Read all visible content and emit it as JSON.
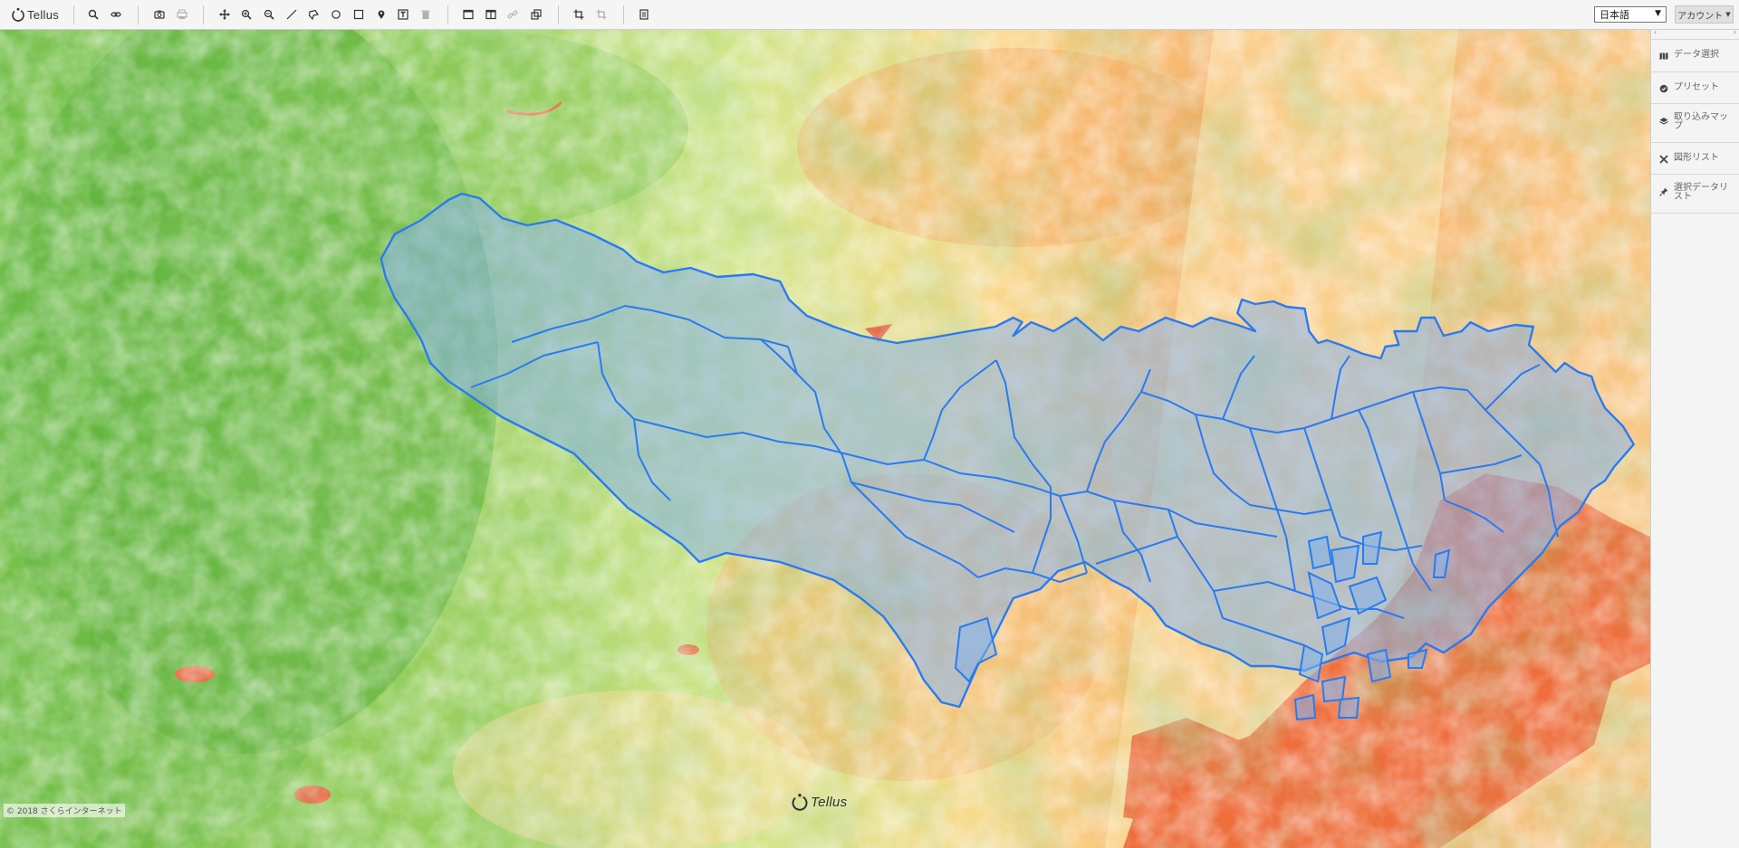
{
  "app": {
    "logo_text": "Tellus"
  },
  "toolbar": {
    "icons": [
      {
        "name": "search-icon"
      },
      {
        "name": "link-icon"
      },
      {
        "name": "camera-icon"
      },
      {
        "name": "print-icon"
      },
      {
        "name": "pan-icon"
      },
      {
        "name": "zoom-in-icon"
      },
      {
        "name": "zoom-out-icon"
      },
      {
        "name": "draw-line-icon"
      },
      {
        "name": "draw-polygon-icon"
      },
      {
        "name": "draw-circle-icon"
      },
      {
        "name": "draw-rectangle-icon"
      },
      {
        "name": "marker-icon"
      },
      {
        "name": "text-icon"
      },
      {
        "name": "trash-icon"
      },
      {
        "name": "single-view-icon"
      },
      {
        "name": "split-view-icon"
      },
      {
        "name": "sync-link-icon"
      },
      {
        "name": "overlay-icon"
      },
      {
        "name": "crop-icon"
      },
      {
        "name": "crop-disabled-icon"
      },
      {
        "name": "document-icon"
      }
    ]
  },
  "language": {
    "selected": "日本語"
  },
  "account": {
    "label": "アカウント"
  },
  "panel": {
    "items": [
      {
        "icon": "map-icon",
        "label": "データ選択"
      },
      {
        "icon": "preset-icon",
        "label": "プリセット"
      },
      {
        "icon": "layers-icon",
        "label": "取り込みマップ"
      },
      {
        "icon": "shape-list-icon",
        "label": "図形リスト"
      },
      {
        "icon": "pin-icon",
        "label": "選択データリスト"
      }
    ]
  },
  "map": {
    "copyright": "© 2018 さくらインターネット",
    "watermark": "Tellus",
    "colors": {
      "vegetation_dense": "#4fae3a",
      "vegetation": "#8fcc5a",
      "light_green": "#cbe58a",
      "pale_yellow": "#fde9a0",
      "orange": "#f5a05a",
      "urban_red": "#ee7040",
      "water_red": "#ea6a3c",
      "boundary_line": "#2a7bef",
      "boundary_fill": "#86b0e6"
    }
  }
}
